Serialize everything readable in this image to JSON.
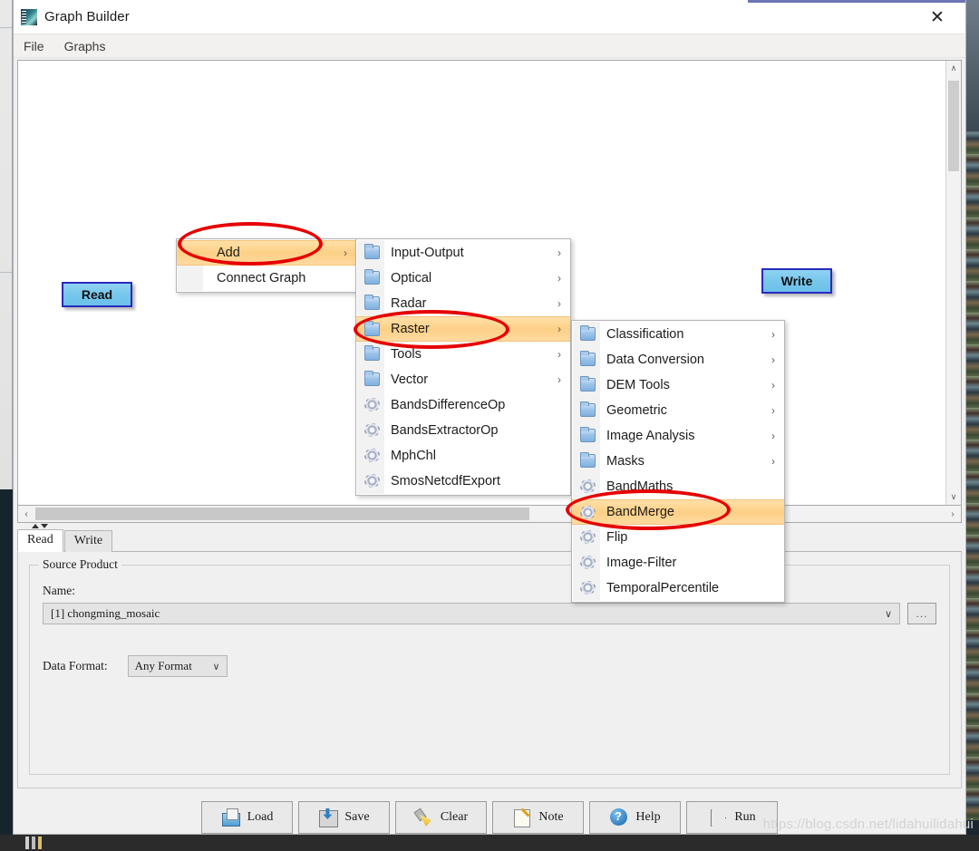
{
  "window": {
    "title": "Graph Builder",
    "icon": "app-icon",
    "close_label": "✕"
  },
  "menubar": {
    "items": [
      {
        "label": "File",
        "open": false
      },
      {
        "label": "Graphs",
        "open": true
      }
    ]
  },
  "canvas": {
    "nodes": [
      {
        "label": "Read",
        "type": "source"
      },
      {
        "label": "Write",
        "type": "target"
      }
    ],
    "vscroll": {
      "up": "∧",
      "down": "∨"
    },
    "hscroll": {
      "left": "‹",
      "right": "›"
    }
  },
  "context_menu": {
    "level1": [
      {
        "label": "Add",
        "submenu": true,
        "highlighted": true,
        "icon": "none"
      },
      {
        "label": "Connect Graph",
        "submenu": false,
        "highlighted": false,
        "icon": "none"
      }
    ],
    "level2": [
      {
        "label": "Input-Output",
        "submenu": true,
        "highlighted": false,
        "icon": "folder-icon"
      },
      {
        "label": "Optical",
        "submenu": true,
        "highlighted": false,
        "icon": "folder-icon"
      },
      {
        "label": "Radar",
        "submenu": true,
        "highlighted": false,
        "icon": "folder-icon"
      },
      {
        "label": "Raster",
        "submenu": true,
        "highlighted": true,
        "icon": "folder-icon"
      },
      {
        "label": "Tools",
        "submenu": true,
        "highlighted": false,
        "icon": "folder-icon"
      },
      {
        "label": "Vector",
        "submenu": true,
        "highlighted": false,
        "icon": "folder-icon"
      },
      {
        "label": "BandsDifferenceOp",
        "submenu": false,
        "highlighted": false,
        "icon": "gear-icon"
      },
      {
        "label": "BandsExtractorOp",
        "submenu": false,
        "highlighted": false,
        "icon": "gear-icon"
      },
      {
        "label": "MphChl",
        "submenu": false,
        "highlighted": false,
        "icon": "gear-icon"
      },
      {
        "label": "SmosNetcdfExport",
        "submenu": false,
        "highlighted": false,
        "icon": "gear-icon"
      }
    ],
    "level3": [
      {
        "label": "Classification",
        "submenu": true,
        "highlighted": false,
        "icon": "folder-icon"
      },
      {
        "label": "Data Conversion",
        "submenu": true,
        "highlighted": false,
        "icon": "folder-icon"
      },
      {
        "label": "DEM Tools",
        "submenu": true,
        "highlighted": false,
        "icon": "folder-icon"
      },
      {
        "label": "Geometric",
        "submenu": true,
        "highlighted": false,
        "icon": "folder-icon"
      },
      {
        "label": "Image Analysis",
        "submenu": true,
        "highlighted": false,
        "icon": "folder-icon"
      },
      {
        "label": "Masks",
        "submenu": true,
        "highlighted": false,
        "icon": "folder-icon"
      },
      {
        "label": "BandMaths",
        "submenu": false,
        "highlighted": false,
        "icon": "gear-icon"
      },
      {
        "label": "BandMerge",
        "submenu": false,
        "highlighted": true,
        "icon": "gear-icon"
      },
      {
        "label": "Flip",
        "submenu": false,
        "highlighted": false,
        "icon": "gear-icon"
      },
      {
        "label": "Image-Filter",
        "submenu": false,
        "highlighted": false,
        "icon": "gear-icon"
      },
      {
        "label": "TemporalPercentile",
        "submenu": false,
        "highlighted": false,
        "icon": "gear-icon"
      }
    ],
    "submenu_arrow": "›"
  },
  "properties": {
    "tabs": [
      {
        "label": "Read",
        "active": true
      },
      {
        "label": "Write",
        "active": false
      }
    ],
    "group_title": "Source Product",
    "name_label": "Name:",
    "name_value": "[1] chongming_mosaic",
    "browse_label": "...",
    "data_format_label": "Data Format:",
    "data_format_value": "Any Format",
    "caret": "∨"
  },
  "actions": [
    {
      "label": "Load",
      "icon": "folder-open-icon"
    },
    {
      "label": "Save",
      "icon": "save-disk-icon"
    },
    {
      "label": "Clear",
      "icon": "broom-icon"
    },
    {
      "label": "Note",
      "icon": "notepad-pencil-icon"
    },
    {
      "label": "Help",
      "icon": "question-circle-icon"
    },
    {
      "label": "Run",
      "icon": "play-triangle-icon"
    }
  ],
  "annotations": {
    "ellipse_color": "#e60000",
    "targets": [
      "Add",
      "Raster",
      "BandMerge"
    ]
  },
  "watermark": "https://blog.csdn.net/lidahuilidahui",
  "colors": {
    "node_fill": "#77c7ec",
    "node_border": "#2a2ac0",
    "menu_highlight": "#fdd086",
    "window_bg": "#f0f0f0",
    "title_accent": "#6d74b5"
  }
}
